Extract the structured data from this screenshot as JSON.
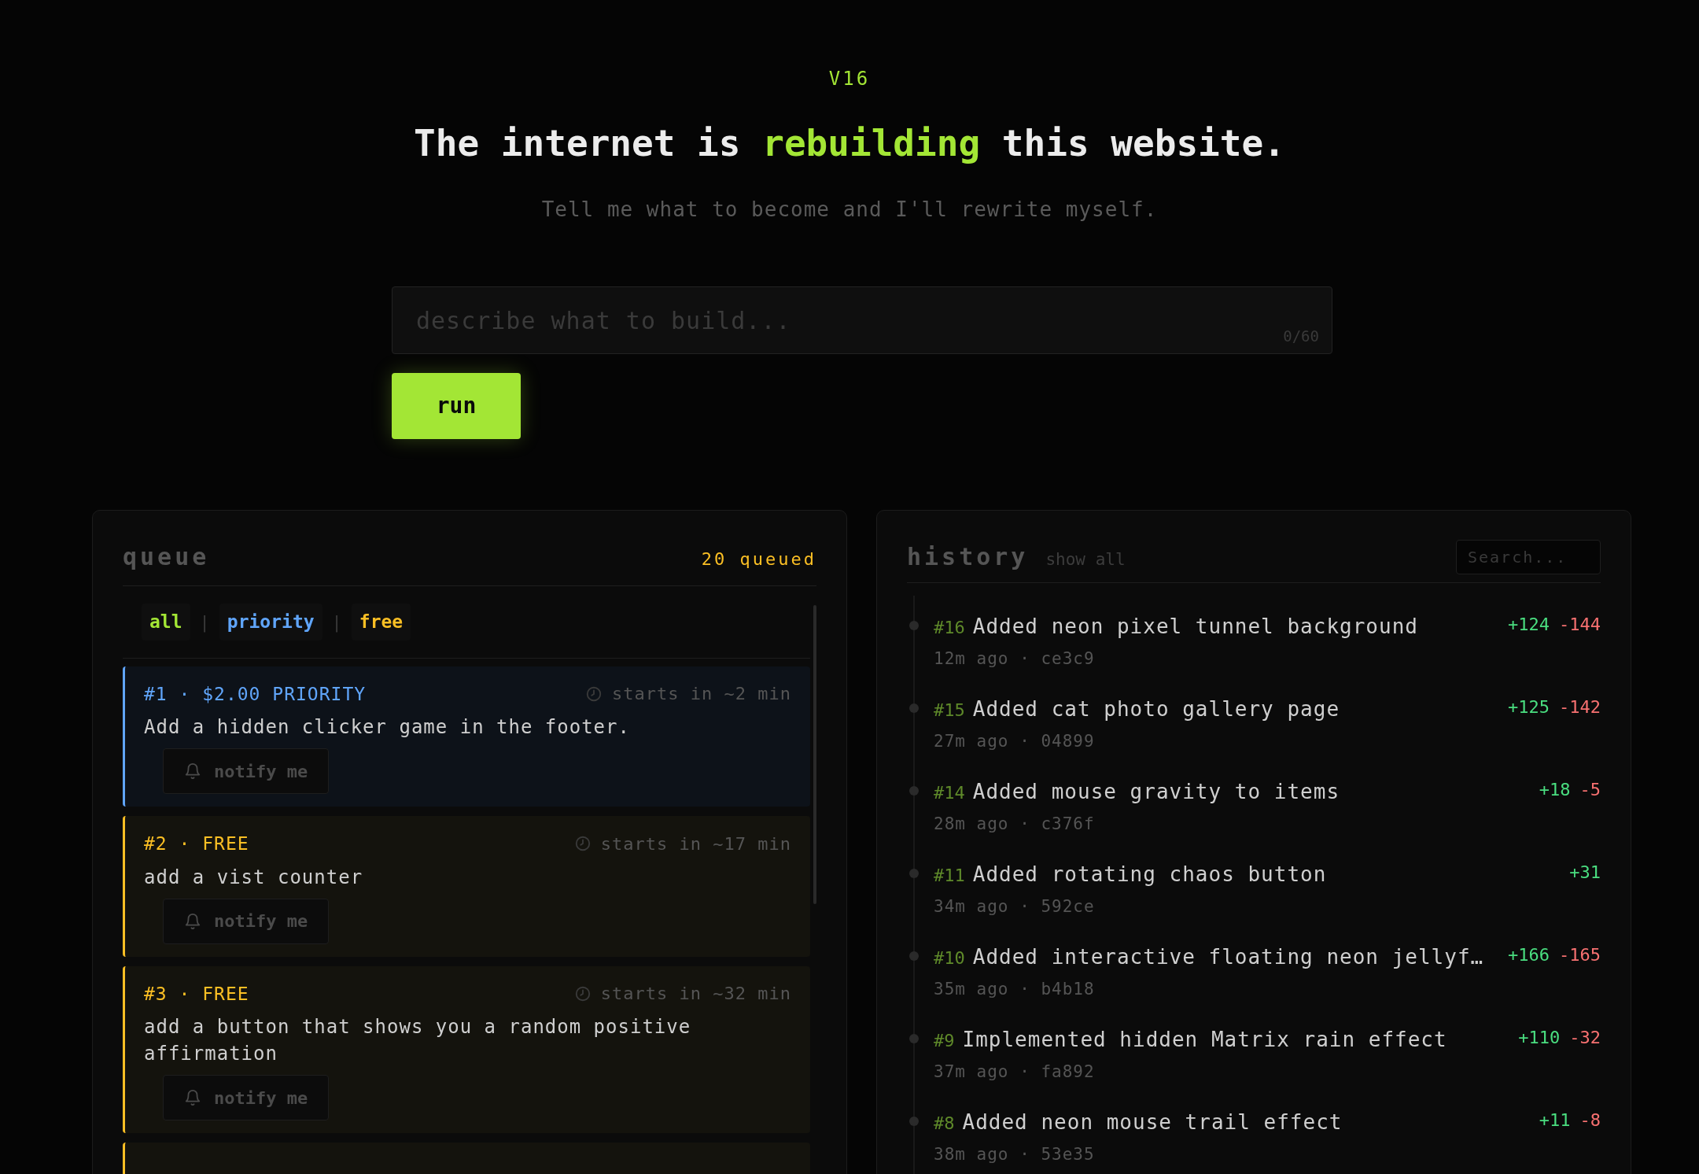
{
  "version": "V16",
  "headline": {
    "before": "The internet is ",
    "highlight": "rebuilding",
    "after": " this website."
  },
  "subtitle": "Tell me what to become and I'll rewrite myself.",
  "prompt": {
    "placeholder": "describe what to build...",
    "counter": "0/60"
  },
  "run_button": "run",
  "queue": {
    "title": "queue",
    "count": "20 queued",
    "filters": [
      {
        "label": "all",
        "color": "#a3e635"
      },
      {
        "label": "priority",
        "color": "#60a5fa"
      },
      {
        "label": "free",
        "color": "#fbbf24"
      }
    ],
    "separators": [
      "|",
      "|"
    ],
    "items": [
      {
        "kind": "priority",
        "label": "#1 · $2.00 PRIORITY",
        "eta": "starts in ~2 min",
        "text": "Add a hidden clicker game in the footer.",
        "notify": "notify me"
      },
      {
        "kind": "free",
        "label": "#2 · FREE",
        "eta": "starts in ~17 min",
        "text": "add a vist counter",
        "notify": "notify me"
      },
      {
        "kind": "free",
        "label": "#3 · FREE",
        "eta": "starts in ~32 min",
        "text": "add a button that shows you a random positive affirmation",
        "notify": "notify me"
      },
      {
        "kind": "free"
      }
    ]
  },
  "history": {
    "title": "history",
    "show_all": "show all",
    "search": {
      "placeholder": "Search..."
    },
    "items": [
      {
        "number": "#16",
        "title": "Added neon pixel tunnel background",
        "meta": "12m ago · ce3c9",
        "added": "+124",
        "removed": "-144"
      },
      {
        "number": "#15",
        "title": "Added cat photo gallery page",
        "meta": "27m ago · 04899",
        "added": "+125",
        "removed": "-142"
      },
      {
        "number": "#14",
        "title": "Added mouse gravity to items",
        "meta": "28m ago · c376f",
        "added": "+18",
        "removed": "-5"
      },
      {
        "number": "#11",
        "title": "Added rotating chaos button",
        "meta": "34m ago · 592ce",
        "added": "+31"
      },
      {
        "number": "#10",
        "title": "Added interactive floating neon jellyf…",
        "meta": "35m ago · b4b18",
        "added": "+166",
        "removed": "-165"
      },
      {
        "number": "#9",
        "title": "Implemented hidden Matrix rain effect",
        "meta": "37m ago · fa892",
        "added": "+110",
        "removed": "-32"
      },
      {
        "number": "#8",
        "title": "Added neon mouse trail effect",
        "meta": "38m ago · 53e35",
        "added": "+11",
        "removed": "-8"
      }
    ]
  }
}
